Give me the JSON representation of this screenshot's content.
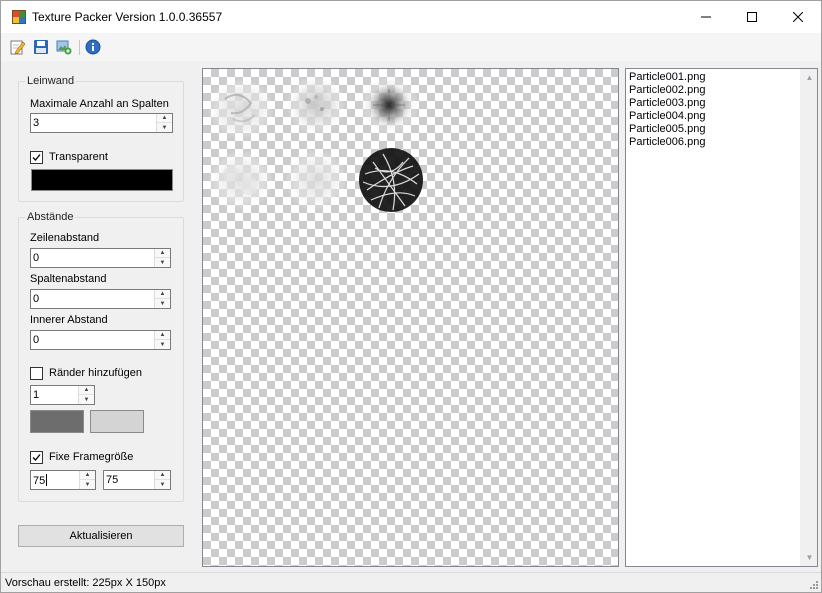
{
  "window": {
    "title": "Texture Packer Version 1.0.0.36557",
    "controls": {
      "minimize": "—",
      "maximize": "☐",
      "close": "✕"
    }
  },
  "toolbar": {
    "buttons": [
      {
        "icon": "edit-icon"
      },
      {
        "icon": "save-icon"
      },
      {
        "icon": "export-icon"
      },
      {
        "icon": "info-icon"
      }
    ]
  },
  "canvas_group": {
    "title": "Leinwand",
    "max_columns_label": "Maximale Anzahl an Spalten",
    "max_columns_value": "3",
    "transparent_label": "Transparent",
    "transparent_checked": true,
    "background_color": "#000000"
  },
  "spacing_group": {
    "title": "Abstände",
    "row_spacing_label": "Zeilenabstand",
    "row_spacing_value": "0",
    "column_spacing_label": "Spaltenabstand",
    "column_spacing_value": "0",
    "inner_padding_label": "Innerer Abstand",
    "inner_padding_value": "0",
    "add_borders_label": "Ränder hinzufügen",
    "add_borders_checked": false,
    "border_width_value": "1",
    "border_color_1": "#6d6d6d",
    "border_color_2": "#d4d4d4",
    "fixed_frame_label": "Fixe Framegröße",
    "fixed_frame_checked": true,
    "frame_width_value": "75",
    "frame_height_value": "75"
  },
  "update_button": "Aktualisieren",
  "files": [
    "Particle001.png",
    "Particle002.png",
    "Particle003.png",
    "Particle004.png",
    "Particle005.png",
    "Particle006.png"
  ],
  "status": "Vorschau erstellt: 225px X 150px"
}
